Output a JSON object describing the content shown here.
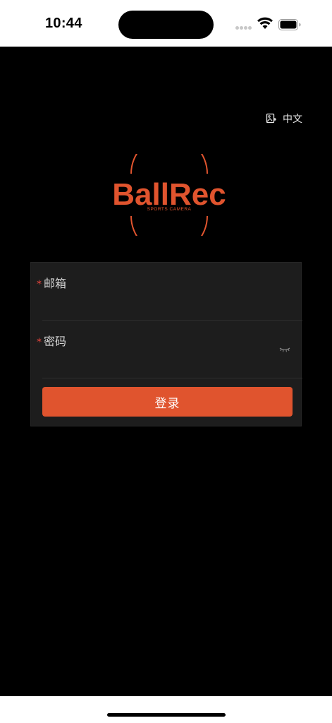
{
  "status_bar": {
    "time": "10:44"
  },
  "header": {
    "language_label": "中文"
  },
  "logo": {
    "brand_name": "BallRec",
    "tagline": "SPORTS CAMERA",
    "brand_color": "#E0542E"
  },
  "form": {
    "email": {
      "label": "邮箱",
      "required_mark": "*",
      "value": "",
      "placeholder": ""
    },
    "password": {
      "label": "密码",
      "required_mark": "*",
      "value": "",
      "placeholder": ""
    },
    "submit_label": "登录"
  },
  "icons": {
    "language": "language-image-icon",
    "password_toggle": "eye-closed-icon"
  },
  "colors": {
    "background": "#000000",
    "form_background": "#1D1D1D",
    "accent": "#E0542E",
    "required": "#E8453C"
  }
}
